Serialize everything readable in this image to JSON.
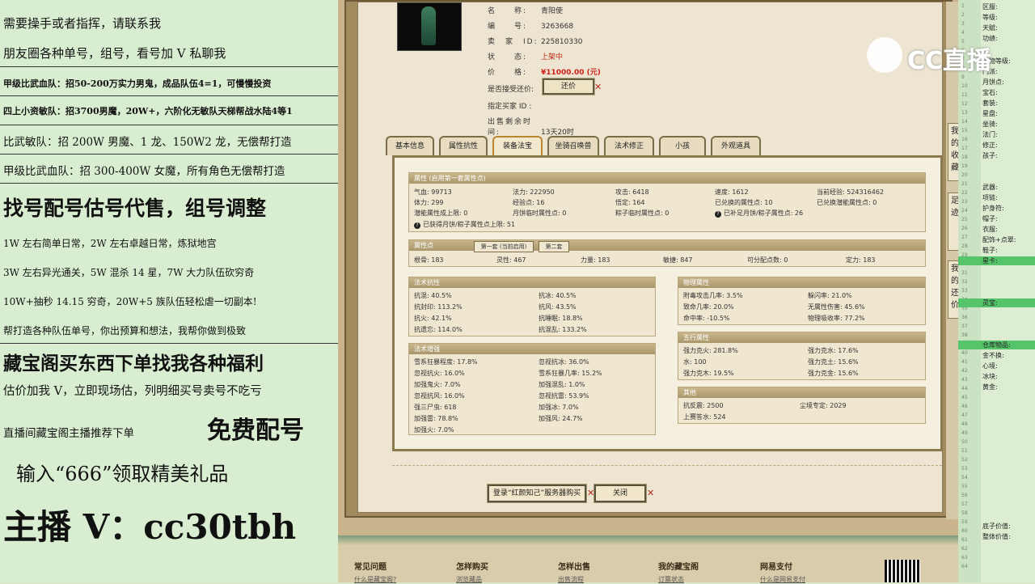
{
  "left_panel": {
    "lines": [
      "需要操手或者指挥，请联系我",
      "朋友圈各种单号，组号，看号加 V 私聊我",
      "甲级比武血队：招50-200万实力男鬼，成品队伍4=1，可慢慢投资",
      "四上小资敏队：招3700男魔，20W+，六阶化无敏队天梯帮战水陆4等1",
      "比武敏队：招 200W 男魔、1 龙、150W2 龙，无偿帮打造",
      "甲级比武血队：招 300-400W 女魔，所有角色无偿帮打造",
      "找号配号估号代售，组号调整",
      "1W 左右简单日常，2W 左右卓越日常，炼狱地宫",
      "3W 左右异光通关，5W 混杀 14 星，7W 大力队伍砍穷奇",
      "10W+抽秒 14.15 穷奇，20W+5 族队伍轻松虐一切副本!",
      "帮打造各种队伍单号，你出预算和想法，我帮你做到极致",
      "藏宝阁买东西下单找我各种福利",
      "估价加我 V，立即现场估，列明细买号卖号不吃亏",
      "直播间藏宝阁主播推荐下单",
      "免费配号",
      "输入“666”领取精美礼品",
      "主播 V：cc30tbh"
    ]
  },
  "item_info": {
    "name_label": "名　　称:",
    "name_value": "青阳使",
    "id_label": "编　　号:",
    "id_value": "3263668",
    "seller_label": "卖　家　ID:",
    "seller_value": "225810330",
    "status_label": "状　　态:",
    "status_value": "上架中",
    "price_label": "价　　格:",
    "price_value": "¥11000.00 (元)",
    "bargain_label": "是否接受还价:",
    "bargain_button": "还价",
    "buyer_label": "指定买家 ID :",
    "time_label": "出售剩余时间:",
    "time_value": "13天20时"
  },
  "tabs": [
    "基本信息",
    "属性抗性",
    "装备法宝",
    "坐骑召唤兽",
    "法术修正",
    "小孩",
    "外观道具"
  ],
  "attr_section": {
    "title": "属性 (启用第一套属性点)",
    "rows": [
      [
        "气血: 99713",
        "法力: 222950",
        "攻击: 6418",
        "速度: 1612",
        "当前经验: 524316462"
      ],
      [
        "体力: 299",
        "经验点: 16",
        "悟定: 164",
        "已兑换的属性点: 10",
        "已兑换潜能属性点: 0"
      ],
      [
        "潜能属性成上限: 0",
        "月饼临时属性点: 0",
        "粽子临时属性点: 0",
        "已补足月饼/粽子属性点: 26",
        ""
      ]
    ],
    "note": "已获得月饼/粽子属性点上限: 51"
  },
  "points_section": {
    "title": "属性点",
    "subtab1": "第一套 (当前启用)",
    "subtab2": "第二套",
    "row": [
      "根骨: 183",
      "灵性: 467",
      "力量: 183",
      "敏捷: 847",
      "可分配点数: 0",
      "定力: 183"
    ]
  },
  "resist_section": {
    "title": "法术抗性",
    "rows": [
      [
        "抗混: 40.5%",
        "抗冰: 40.5%"
      ],
      [
        "抗封印: 113.2%",
        "抗风: 43.5%"
      ],
      [
        "抗火: 42.1%",
        "抗睡眠: 18.8%"
      ],
      [
        "抗遗忘: 114.0%",
        "抗混乱: 133.2%"
      ]
    ]
  },
  "boost_section": {
    "title": "法术增强",
    "rows": [
      [
        "雪系狂暴程度: 17.8%",
        "忽视抗冰: 36.0%"
      ],
      [
        "忽视抗火: 16.0%",
        "雪系狂暴几率: 15.2%"
      ],
      [
        "加强鬼火: 7.0%",
        "加强混乱: 1.0%"
      ],
      [
        "忽视抗风: 16.0%",
        "忽视抗雷: 53.9%"
      ],
      [
        "强三尸虫: 618",
        "加强冰: 7.0%"
      ],
      [
        "加强雷: 78.8%",
        "加强风: 24.7%"
      ],
      [
        "加强火: 7.0%",
        ""
      ]
    ]
  },
  "physical_section": {
    "title": "物理属性",
    "rows": [
      [
        "附毒攻击几率: 3.5%",
        "躲闪率: 21.0%"
      ],
      [
        "致命几率: 20.0%",
        "无属性伤害: 45.6%"
      ],
      [
        "命中率: -10.5%",
        "物理吸收率: 77.2%"
      ]
    ]
  },
  "elements_section": {
    "title": "五行属性",
    "rows": [
      [
        "强力克火: 281.8%",
        "强力克水: 17.6%"
      ],
      [
        "水: 100",
        "强力克土: 15.6%"
      ],
      [
        "强力克木: 19.5%",
        "强力克金: 15.6%"
      ]
    ]
  },
  "other_section": {
    "title": "其他",
    "rows": [
      [
        "抗反震: 2500",
        "尘境专定: 2029"
      ],
      [
        "上赛答水: 524",
        ""
      ]
    ]
  },
  "buttons": {
    "login_buy": "登录“红颜知己”服务器购买",
    "close": "关闭"
  },
  "side_tabs": [
    "我的收藏",
    "足迹",
    "我的还价"
  ],
  "footer": {
    "cols": [
      "常见问题",
      "怎样购买",
      "怎样出售",
      "我的藏宝阁",
      "网易支付"
    ],
    "subs": [
      "什么是藏宝阁?",
      "浏览藏品",
      "出售流程",
      "订票状态",
      "什么是网易支付"
    ]
  },
  "logo": {
    "text": "CC直播"
  },
  "right_panel": {
    "items": [
      "区服:",
      "等级:",
      "天赋:",
      "功绩:",
      "人物等级:",
      "门派:",
      "月饼点:",
      "宝石:",
      "套装:",
      "星盘:",
      "坐骑:",
      "法门:",
      "修正:",
      "孩子:",
      "武器:",
      "项链:",
      "护身符:",
      "帽子:",
      "衣服:",
      "配饰+点翠:",
      "鞋子:",
      "星卡:",
      "灵宝:",
      "仓库物品:",
      "金不换:",
      "心境:",
      "冰块:",
      "黄金:",
      "底子价值:",
      "整体价值:"
    ],
    "gutter_numbers": [
      "1",
      "2",
      "3",
      "4",
      "5",
      "6",
      "7",
      "8",
      "9",
      "10",
      "11",
      "12",
      "13",
      "14",
      "15",
      "16",
      "17",
      "18",
      "19",
      "20",
      "21",
      "22",
      "23",
      "24",
      "25",
      "26",
      "27",
      "28",
      "29",
      "30",
      "31",
      "32",
      "33",
      "34",
      "35",
      "36",
      "37",
      "38",
      "39",
      "40",
      "41",
      "42",
      "43",
      "44",
      "45",
      "46",
      "47",
      "48",
      "49",
      "50",
      "51",
      "52",
      "53",
      "54",
      "55",
      "56",
      "57",
      "58",
      "59",
      "60",
      "61",
      "62",
      "63",
      "64"
    ]
  }
}
